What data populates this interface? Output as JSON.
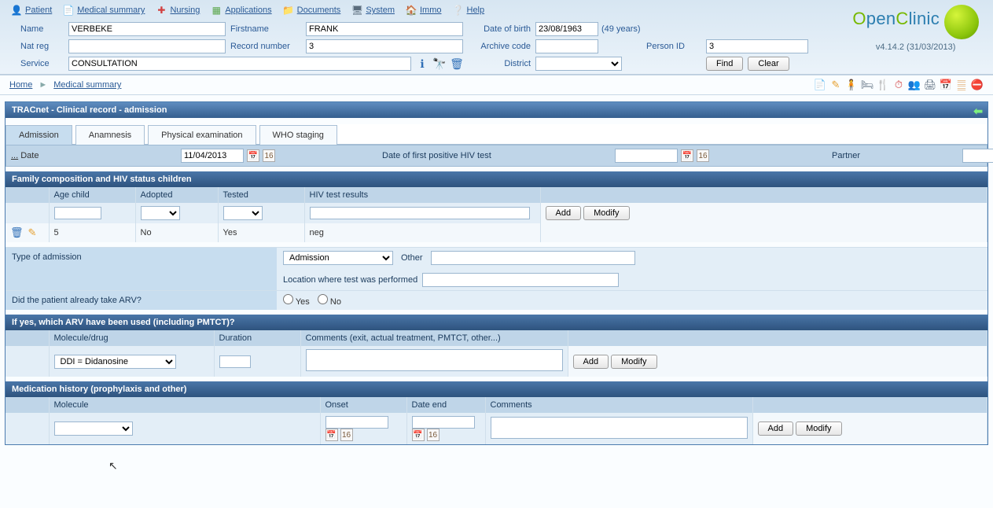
{
  "menu": {
    "patient": "Patient",
    "medical_summary": "Medical summary",
    "nursing": "Nursing",
    "applications": "Applications",
    "documents": "Documents",
    "system": "System",
    "immo": "Immo",
    "help": "Help"
  },
  "logo": {
    "brand": "OpenClinic",
    "version": "v4.14.2 (31/03/2013)"
  },
  "patient_form": {
    "labels": {
      "name": "Name",
      "firstname": "Firstname",
      "dob": "Date of birth",
      "age_suffix": "(49 years)",
      "natreg": "Nat reg",
      "recordnum": "Record number",
      "archive": "Archive code",
      "personid": "Person ID",
      "service": "Service",
      "district": "District"
    },
    "values": {
      "name": "VERBEKE",
      "firstname": "FRANK",
      "dob": "23/08/1963",
      "natreg": "",
      "recordnum": "3",
      "archive": "",
      "personid": "3",
      "service": "CONSULTATION",
      "district": ""
    },
    "buttons": {
      "find": "Find",
      "clear": "Clear"
    }
  },
  "breadcrumb": {
    "home": "Home",
    "sep": "►",
    "page": "Medical summary"
  },
  "panel": {
    "title": "TRACnet - Clinical record - admission"
  },
  "tabs": {
    "admission": "Admission",
    "anamnesis": "Anamnesis",
    "physical": "Physical examination",
    "who": "WHO staging"
  },
  "admission_row": {
    "prefix": "...",
    "date_label": "Date",
    "date_value": "11/04/2013",
    "first_pos_label": "Date of first positive HIV test",
    "first_pos_value": "",
    "partner_label": "Partner"
  },
  "family": {
    "header": "Family composition and HIV status children",
    "cols": {
      "age": "Age child",
      "adopted": "Adopted",
      "tested": "Tested",
      "results": "HIV test results"
    },
    "buttons": {
      "add": "Add",
      "modify": "Modify"
    },
    "rows": [
      {
        "age": "5",
        "adopted": "No",
        "tested": "Yes",
        "results": "neg"
      }
    ]
  },
  "admission_type": {
    "label": "Type of admission",
    "select_value": "Admission",
    "other_label": "Other",
    "location_label": "Location where test was performed"
  },
  "arv_question": {
    "label": "Did the patient already take ARV?",
    "yes": "Yes",
    "no": "No"
  },
  "arv_used": {
    "header": "If yes, which ARV have been used (including PMTCT)?",
    "cols": {
      "molecule": "Molecule/drug",
      "duration": "Duration",
      "comments": "Comments (exit, actual treatment, PMTCT, other...)"
    },
    "select_value": "DDI = Didanosine",
    "buttons": {
      "add": "Add",
      "modify": "Modify"
    }
  },
  "med_history": {
    "header": "Medication history (prophylaxis and other)",
    "cols": {
      "molecule": "Molecule",
      "onset": "Onset",
      "date_end": "Date end",
      "comments": "Comments"
    },
    "buttons": {
      "add": "Add",
      "modify": "Modify"
    }
  }
}
